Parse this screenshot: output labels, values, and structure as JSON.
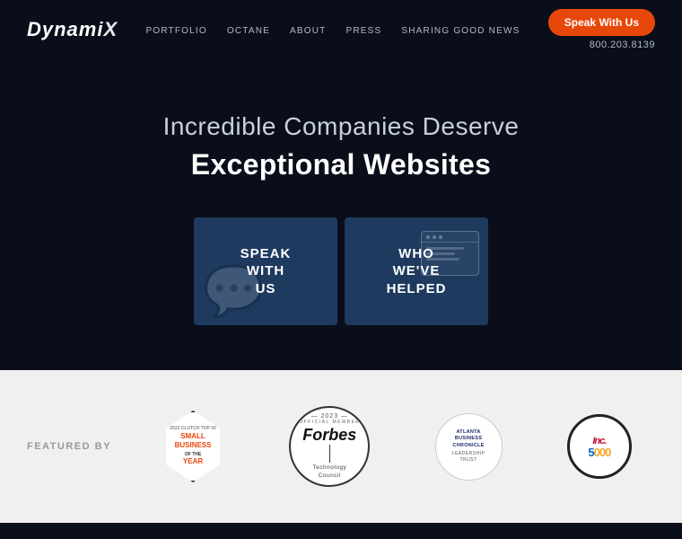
{
  "navbar": {
    "logo": "DynamiX",
    "nav_items": [
      {
        "label": "PORTFOLIO",
        "href": "#"
      },
      {
        "label": "OCTANE",
        "href": "#"
      },
      {
        "label": "ABOUT",
        "href": "#"
      },
      {
        "label": "PRESS",
        "href": "#"
      },
      {
        "label": "SHARING GOOD NEWS",
        "href": "#"
      }
    ],
    "speak_button": "Speak With Us",
    "phone": "800.203.8139"
  },
  "hero": {
    "subtitle": "Incredible Companies Deserve",
    "title": "Exceptional Websites"
  },
  "cta_cards": [
    {
      "id": "speak",
      "label": "SPEAK\nWITH\nUS"
    },
    {
      "id": "who",
      "label": "WHO\nWE'VE\nHELPED"
    }
  ],
  "featured": {
    "label": "FEATURED BY",
    "badges": [
      {
        "name": "Clutch Small Business of the Year"
      },
      {
        "name": "Forbes Technology Council"
      },
      {
        "name": "Atlanta Business Chronicle Leadership Trust"
      },
      {
        "name": "Inc 5000"
      }
    ]
  }
}
